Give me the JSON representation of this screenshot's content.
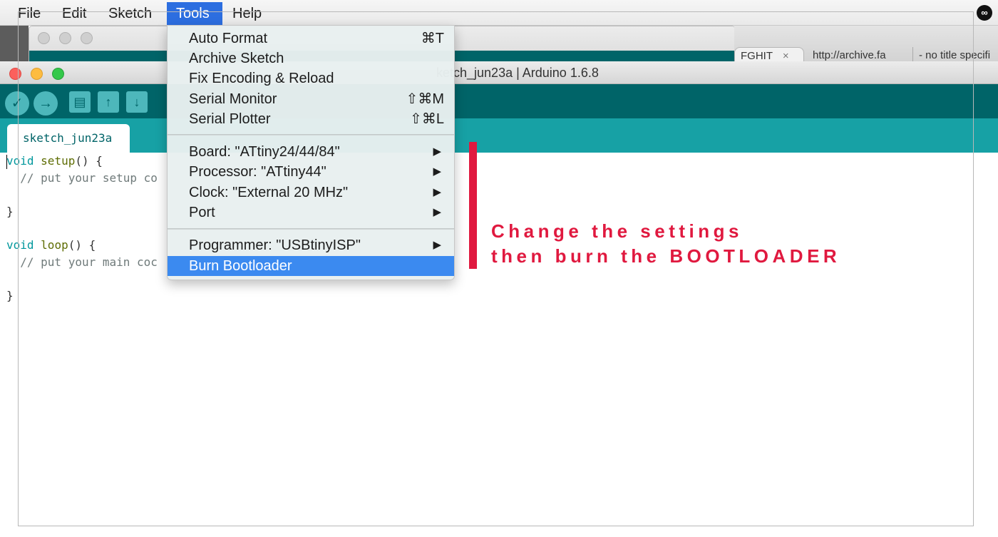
{
  "menubar": {
    "items": [
      "File",
      "Edit",
      "Sketch",
      "Tools",
      "Help"
    ],
    "active": "Tools",
    "status_icon": "creative-cloud-icon"
  },
  "background_windows": {
    "browser_tabs": [
      "FGHIT",
      "http://archive.fa",
      "- no title specifi"
    ],
    "tab_close": "×"
  },
  "window": {
    "title": "sketch_jun23a | Arduino 1.6.8",
    "visible_title": "ketch_jun23a | Arduino 1.6.8",
    "toolbar_icons": [
      "verify-icon",
      "upload-icon",
      "new-icon",
      "open-icon",
      "save-icon"
    ],
    "tab_label": "sketch_jun23a"
  },
  "code": {
    "line1_kw": "void",
    "line1_fn": "setup",
    "line1_rest": "() {",
    "line2": "  // put your setup co",
    "line3": "}",
    "line5_kw": "void",
    "line5_fn": "loop",
    "line5_rest": "() {",
    "line6": "  // put your main coc",
    "line7": "}"
  },
  "tools_menu": {
    "group1": [
      {
        "label": "Auto Format",
        "shortcut": "⌘T"
      },
      {
        "label": "Archive Sketch",
        "shortcut": ""
      },
      {
        "label": "Fix Encoding & Reload",
        "shortcut": ""
      },
      {
        "label": "Serial Monitor",
        "shortcut": "⇧⌘M"
      },
      {
        "label": "Serial Plotter",
        "shortcut": "⇧⌘L"
      }
    ],
    "group2": [
      {
        "label": "Board: \"ATtiny24/44/84\"",
        "submenu": "▶"
      },
      {
        "label": "Processor: \"ATtiny44\"",
        "submenu": "▶"
      },
      {
        "label": "Clock: \"External 20 MHz\"",
        "submenu": "▶"
      },
      {
        "label": "Port",
        "submenu": "▶"
      }
    ],
    "group3": [
      {
        "label": "Programmer: \"USBtinyISP\"",
        "submenu": "▶"
      },
      {
        "label": "Burn Bootloader",
        "highlighted": true
      }
    ]
  },
  "annotation": {
    "line1": "Change the settings",
    "line2": "then burn the BOOTLOADER",
    "color": "#e0193f"
  },
  "colors": {
    "arduino_teal_dark": "#006468",
    "arduino_teal_light": "#17a1a5",
    "menu_highlight": "#3b8af0"
  }
}
